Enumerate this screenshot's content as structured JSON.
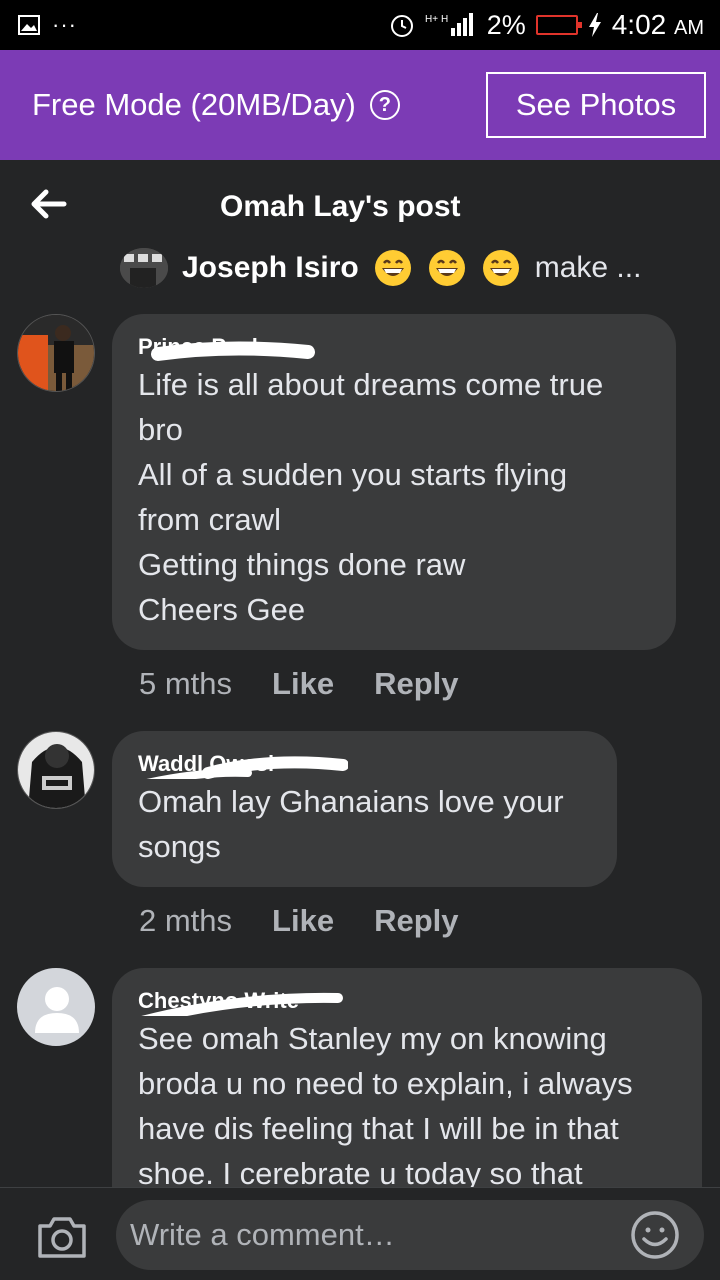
{
  "status_bar": {
    "left_dots": "···",
    "network": "H+ H",
    "battery": "2%",
    "time": "4:02",
    "ampm": "AM"
  },
  "banner": {
    "text": "Free Mode (20MB/Day)",
    "help": "?",
    "button": "See Photos",
    "color": "#7c3bb5"
  },
  "header": {
    "title": "Omah Lay's post"
  },
  "reply_preview": {
    "name": "Joseph Isiro",
    "emojis": [
      "grinning-face-emoji",
      "grinning-face-emoji",
      "grinning-face-emoji"
    ],
    "text": "make ..."
  },
  "comments": [
    {
      "author": "Prince Paul",
      "text": "Life is all about dreams come true\nbro\nAll of a sudden you starts flying\nfrom crawl\nGetting things done raw\nCheers Gee",
      "time": "5 mths",
      "like": "Like",
      "reply": "Reply"
    },
    {
      "author": "Waddl Qwesi",
      "text": "Omah lay Ghanaians love your\nsongs",
      "time": "2 mths",
      "like": "Like",
      "reply": "Reply"
    },
    {
      "author": "Chestyno Write",
      "text": "See omah Stanley my on knowing\nbroda u no need to explain, i always\nhave dis feeling that I will be in that\nshoe. I cerebrate u today so that",
      "time": "",
      "like": "Like",
      "reply": "Reply"
    }
  ],
  "composer": {
    "placeholder": "Write a comment…"
  }
}
